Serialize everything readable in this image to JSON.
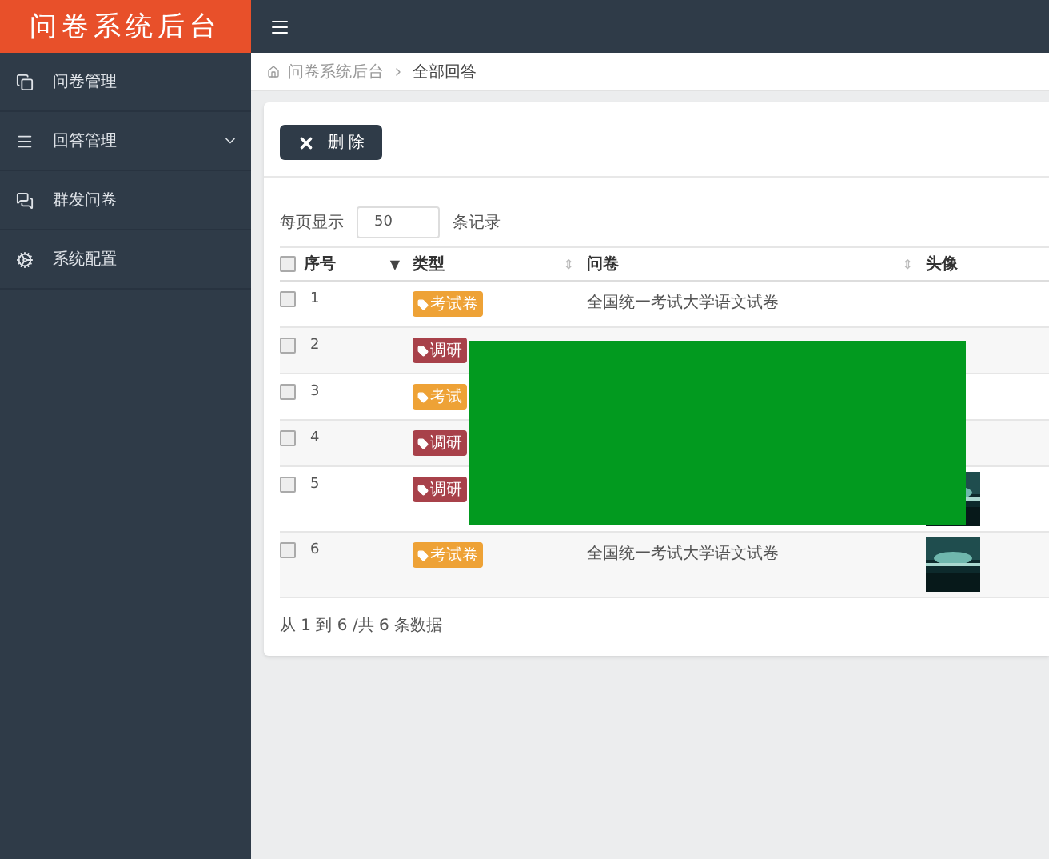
{
  "brand": "问卷系统后台",
  "sidebar": {
    "items": [
      {
        "label": "问卷管理",
        "has_submenu": false
      },
      {
        "label": "回答管理",
        "has_submenu": true
      },
      {
        "label": "群发问卷",
        "has_submenu": false
      },
      {
        "label": "系统配置",
        "has_submenu": false
      }
    ]
  },
  "breadcrumb": [
    "问卷系统后台",
    "全部回答"
  ],
  "toolbar": {
    "delete_button": "删 除"
  },
  "page_size": {
    "prefix": "每页显示",
    "value": "50",
    "suffix": "条记录"
  },
  "table": {
    "header_checked": false,
    "columns": [
      {
        "label": "序号",
        "sort_icon": "▼"
      },
      {
        "label": "类型",
        "sort_icon": "⇕"
      },
      {
        "label": "问卷",
        "sort_icon": "⇕"
      },
      {
        "label": "头像"
      }
    ],
    "rows": [
      {
        "number": "1",
        "checked": false,
        "tag": {
          "kind": "exam",
          "label": "考试卷"
        },
        "questionnaire": "全国统一考试大学语文试卷",
        "avatar": false
      },
      {
        "number": "2",
        "checked": false,
        "tag": {
          "kind": "survey",
          "label": "调研"
        },
        "avatar": false
      },
      {
        "number": "3",
        "checked": false,
        "tag": {
          "kind": "exam",
          "label": "考试"
        },
        "avatar": false
      },
      {
        "number": "4",
        "checked": false,
        "tag": {
          "kind": "survey",
          "label": "调研"
        },
        "avatar": false
      },
      {
        "number": "5",
        "checked": false,
        "tag": {
          "kind": "survey",
          "label": "调研"
        },
        "avatar": true
      },
      {
        "number": "6",
        "checked": false,
        "tag": {
          "kind": "exam",
          "label": "考试卷"
        },
        "questionnaire": "全国统一考试大学语文试卷",
        "avatar": true
      }
    ]
  },
  "footer": "从 1 到 6 /共 6 条数据",
  "overlay": {
    "kind": "redaction"
  }
}
